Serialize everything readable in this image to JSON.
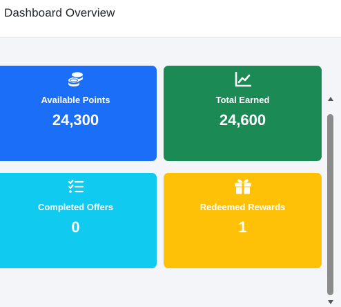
{
  "header": {
    "title": "Dashboard Overview"
  },
  "cards": [
    {
      "label": "Available Points",
      "value": "24,300",
      "color": "#1a6ef8",
      "icon": "coins-icon"
    },
    {
      "label": "Total Earned",
      "value": "24,600",
      "color": "#1b8a55",
      "icon": "chart-line-icon"
    },
    {
      "label": "Completed Offers",
      "value": "0",
      "color": "#10caf0",
      "icon": "list-check-icon"
    },
    {
      "label": "Redeemed Rewards",
      "value": "1",
      "color": "#ffc107",
      "icon": "gift-icon"
    }
  ]
}
